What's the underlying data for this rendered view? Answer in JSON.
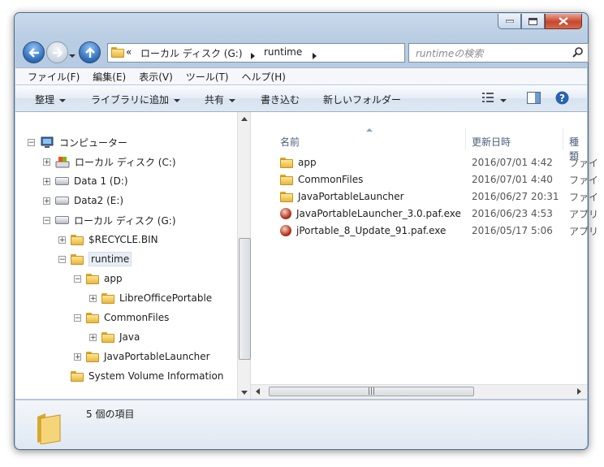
{
  "navigation": {
    "breadcrumb": [
      "«",
      "ローカル ディスク (G:)",
      "runtime"
    ],
    "search_placeholder": "runtimeの検索"
  },
  "menubar": [
    "ファイル(F)",
    "編集(E)",
    "表示(V)",
    "ツール(T)",
    "ヘルプ(H)"
  ],
  "commands": {
    "organize": "整理",
    "add_library": "ライブラリに追加",
    "share": "共有",
    "burn": "書き込む",
    "new_folder": "新しいフォルダー"
  },
  "tree": [
    {
      "label": "コンピューター",
      "icon": "computer-icon",
      "expander": "-"
    },
    {
      "label": "ローカル ディスク (C:)",
      "icon": "drive-c-icon",
      "expander": "+"
    },
    {
      "label": "Data 1 (D:)",
      "icon": "drive-icon",
      "expander": "+"
    },
    {
      "label": "Data2 (E:)",
      "icon": "drive-icon",
      "expander": "+"
    },
    {
      "label": "ローカル ディスク (G:)",
      "icon": "drive-icon",
      "expander": "-"
    },
    {
      "label": "$RECYCLE.BIN",
      "icon": "folder-icon",
      "expander": "+"
    },
    {
      "label": "runtime",
      "icon": "folder-icon",
      "expander": "-",
      "selected": true
    },
    {
      "label": "app",
      "icon": "folder-icon",
      "expander": "-"
    },
    {
      "label": "LibreOfficePortable",
      "icon": "folder-icon",
      "expander": "+"
    },
    {
      "label": "CommonFiles",
      "icon": "folder-icon",
      "expander": "-"
    },
    {
      "label": "Java",
      "icon": "folder-icon",
      "expander": "+"
    },
    {
      "label": "JavaPortableLauncher",
      "icon": "folder-icon",
      "expander": "+"
    },
    {
      "label": "System Volume Information",
      "icon": "folder-icon",
      "expander": ""
    }
  ],
  "columns": {
    "name": "名前",
    "date": "更新日時",
    "type": "種類"
  },
  "files": [
    {
      "name": "app",
      "date": "2016/07/01 4:42",
      "type": "ファイ",
      "icon": "folder-icon"
    },
    {
      "name": "CommonFiles",
      "date": "2016/07/01 4:40",
      "type": "ファイ",
      "icon": "folder-icon"
    },
    {
      "name": "JavaPortableLauncher",
      "date": "2016/06/27 20:31",
      "type": "ファイ",
      "icon": "folder-icon"
    },
    {
      "name": "JavaPortableLauncher_3.0.paf.exe",
      "date": "2016/06/23 4:53",
      "type": "アプリ",
      "icon": "installer-icon"
    },
    {
      "name": "jPortable_8_Update_91.paf.exe",
      "date": "2016/05/17 5:06",
      "type": "アプリ",
      "icon": "installer-icon"
    }
  ],
  "status": {
    "item_count": "5 個の項目"
  }
}
